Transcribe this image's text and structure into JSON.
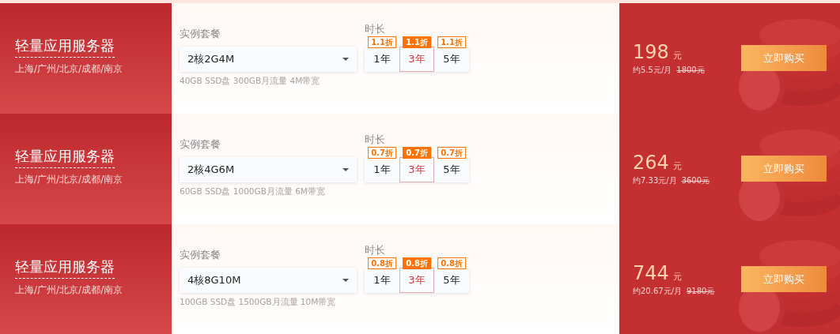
{
  "plans": [
    {
      "title": "轻量应用服务器",
      "regions": "上海/广州/北京/成都/南京",
      "package_label": "实例套餐",
      "package": "2核2G4M",
      "spec": "40GB SSD盘 300GB月流量 4M带宽",
      "duration_label": "时长",
      "durations": [
        {
          "label": "1年",
          "discount": "1.1折",
          "selected": false
        },
        {
          "label": "3年",
          "discount": "1.1折",
          "selected": true
        },
        {
          "label": "5年",
          "discount": "1.1折",
          "selected": false
        }
      ],
      "price": "198",
      "unit": "元",
      "monthly": "约5.5元/月",
      "original": "1800元",
      "button": "立即购买"
    },
    {
      "title": "轻量应用服务器",
      "regions": "上海/广州/北京/成都/南京",
      "package_label": "实例套餐",
      "package": "2核4G6M",
      "spec": "60GB SSD盘 1000GB月流量 6M带宽",
      "duration_label": "时长",
      "durations": [
        {
          "label": "1年",
          "discount": "0.7折",
          "selected": false
        },
        {
          "label": "3年",
          "discount": "0.7折",
          "selected": true
        },
        {
          "label": "5年",
          "discount": "0.7折",
          "selected": false
        }
      ],
      "price": "264",
      "unit": "元",
      "monthly": "约7.33元/月",
      "original": "3600元",
      "button": "立即购买"
    },
    {
      "title": "轻量应用服务器",
      "regions": "上海/广州/北京/成都/南京",
      "package_label": "实例套餐",
      "package": "4核8G10M",
      "spec": "100GB SSD盘 1500GB月流量 10M带宽",
      "duration_label": "时长",
      "durations": [
        {
          "label": "1年",
          "discount": "0.8折",
          "selected": false
        },
        {
          "label": "3年",
          "discount": "0.8折",
          "selected": true
        },
        {
          "label": "5年",
          "discount": "0.8折",
          "selected": false
        }
      ],
      "price": "744",
      "unit": "元",
      "monthly": "约20.67元/月",
      "original": "9180元",
      "button": "立即购买"
    }
  ]
}
